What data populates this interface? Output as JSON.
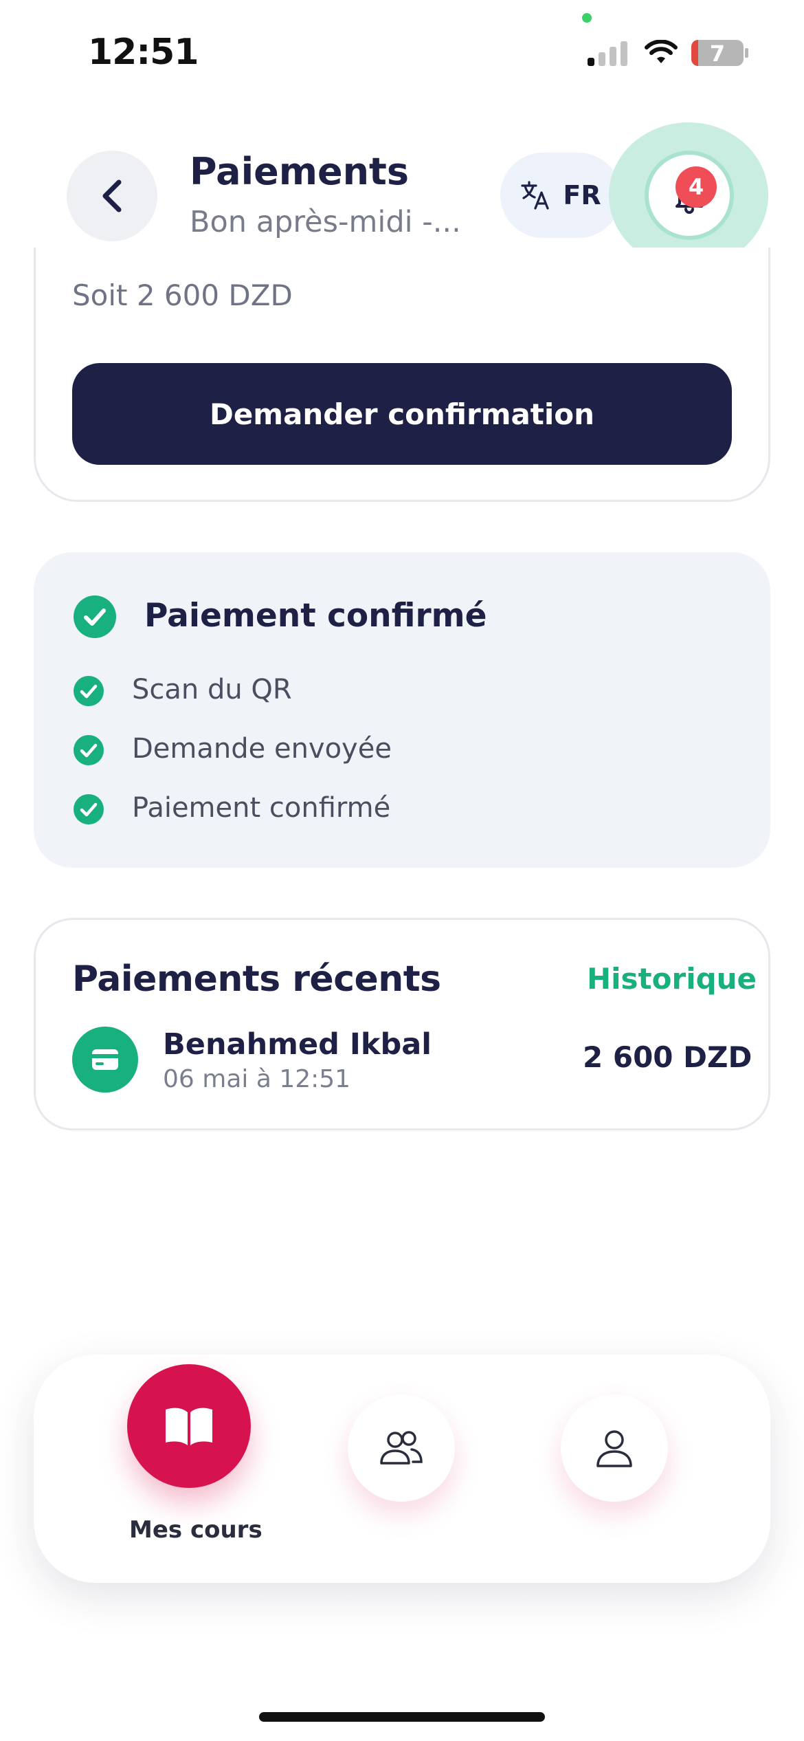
{
  "status_bar": {
    "time": "12:51",
    "battery": "7"
  },
  "header": {
    "title": "Paiements",
    "subtitle": "Bon après-midi -...",
    "language": "FR",
    "notification_count": "4"
  },
  "payment_request": {
    "equivalent": "Soit 2 600 DZD",
    "confirm_button": "Demander confirmation"
  },
  "status_steps": {
    "title": "Paiement confirmé",
    "steps": [
      {
        "label": "Scan du QR"
      },
      {
        "label": "Demande envoyée"
      },
      {
        "label": "Paiement confirmé"
      }
    ]
  },
  "recent_payments": {
    "title": "Paiements récents",
    "history_link": "Historique",
    "items": [
      {
        "name": "Benahmed Ikbal",
        "date": "06 mai à 12:51",
        "amount": "2 600 DZD"
      }
    ]
  },
  "bottom_nav": {
    "items": [
      {
        "label": "Mes cours",
        "icon": "book-icon",
        "active": true
      },
      {
        "label": "",
        "icon": "users-icon",
        "active": false
      },
      {
        "label": "",
        "icon": "user-icon",
        "active": false
      }
    ]
  },
  "colors": {
    "primary": "#1e2145",
    "accent_green": "#19b07f",
    "accent_pink": "#d6124f",
    "badge_red": "#ef4e57"
  }
}
